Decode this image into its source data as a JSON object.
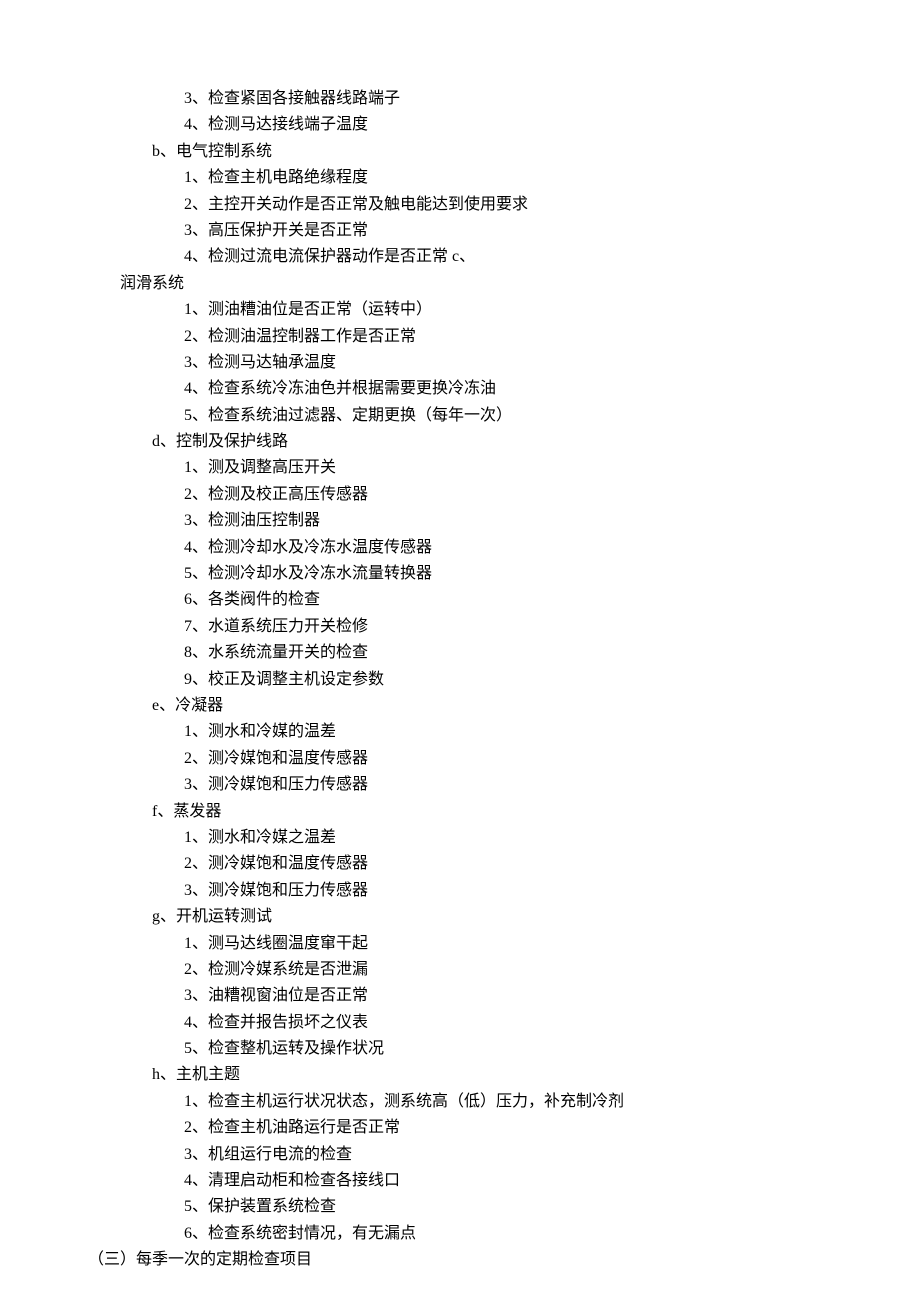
{
  "lines": [
    {
      "indent": "indent-2",
      "text": "3、检查紧固各接触器线路端子"
    },
    {
      "indent": "indent-2",
      "text": "4、检测马达接线端子温度"
    },
    {
      "indent": "indent-1",
      "text": "b、电气控制系统"
    },
    {
      "indent": "indent-2",
      "text": "1、检查主机电路绝缘程度"
    },
    {
      "indent": "indent-2",
      "text": "2、主控开关动作是否正常及触电能达到使用要求"
    },
    {
      "indent": "indent-2",
      "text": "3、高压保护开关是否正常"
    },
    {
      "indent": "indent-2",
      "text": "4、检测过流电流保护器动作是否正常 c、"
    },
    {
      "indent": "indent-0b",
      "text": "润滑系统"
    },
    {
      "indent": "indent-2",
      "text": "1、测油糟油位是否正常（运转中）"
    },
    {
      "indent": "indent-2",
      "text": "2、检测油温控制器工作是否正常"
    },
    {
      "indent": "indent-2",
      "text": "3、检测马达轴承温度"
    },
    {
      "indent": "indent-2",
      "text": "4、检查系统冷冻油色并根据需要更换冷冻油"
    },
    {
      "indent": "indent-2",
      "text": "5、检查系统油过滤器、定期更换（每年一次）"
    },
    {
      "indent": "indent-1",
      "text": "d、控制及保护线路"
    },
    {
      "indent": "indent-2",
      "text": "1、测及调整高压开关"
    },
    {
      "indent": "indent-2",
      "text": "2、检测及校正高压传感器"
    },
    {
      "indent": "indent-2",
      "text": "3、检测油压控制器"
    },
    {
      "indent": "indent-2",
      "text": "4、检测冷却水及冷冻水温度传感器"
    },
    {
      "indent": "indent-2",
      "text": "5、检测冷却水及冷冻水流量转换器"
    },
    {
      "indent": "indent-2",
      "text": "6、各类阀件的检查"
    },
    {
      "indent": "indent-2",
      "text": "7、水道系统压力开关检修"
    },
    {
      "indent": "indent-2",
      "text": "8、水系统流量开关的检查"
    },
    {
      "indent": "indent-2",
      "text": "9、校正及调整主机设定参数"
    },
    {
      "indent": "indent-1",
      "text": "e、冷凝器"
    },
    {
      "indent": "indent-2",
      "text": "1、测水和冷媒的温差"
    },
    {
      "indent": "indent-2",
      "text": "2、测冷媒饱和温度传感器"
    },
    {
      "indent": "indent-2",
      "text": "3、测冷媒饱和压力传感器"
    },
    {
      "indent": "indent-1",
      "text": "f、蒸发器"
    },
    {
      "indent": "indent-2",
      "text": "1、测水和冷媒之温差"
    },
    {
      "indent": "indent-2",
      "text": "2、测冷媒饱和温度传感器"
    },
    {
      "indent": "indent-2",
      "text": "3、测冷媒饱和压力传感器"
    },
    {
      "indent": "indent-1",
      "text": "g、开机运转测试"
    },
    {
      "indent": "indent-2",
      "text": "1、测马达线圈温度窜干起"
    },
    {
      "indent": "indent-2",
      "text": "2、检测冷媒系统是否泄漏"
    },
    {
      "indent": "indent-2",
      "text": "3、油糟视窗油位是否正常"
    },
    {
      "indent": "indent-2",
      "text": "4、检查并报告损坏之仪表"
    },
    {
      "indent": "indent-2",
      "text": "5、检查整机运转及操作状况"
    },
    {
      "indent": "indent-1",
      "text": "h、主机主题"
    },
    {
      "indent": "indent-2",
      "text": "1、检查主机运行状况状态，测系统高（低）压力，补充制冷剂"
    },
    {
      "indent": "indent-2",
      "text": "2、检查主机油路运行是否正常"
    },
    {
      "indent": "indent-2",
      "text": "3、机组运行电流的检查"
    },
    {
      "indent": "indent-2",
      "text": "4、清理启动柜和检查各接线口"
    },
    {
      "indent": "indent-2",
      "text": "5、保护装置系统检查"
    },
    {
      "indent": "indent-2",
      "text": "6、检查系统密封情况，有无漏点"
    },
    {
      "indent": "indent-00",
      "text": "（三）每季一次的定期检查项目"
    }
  ]
}
